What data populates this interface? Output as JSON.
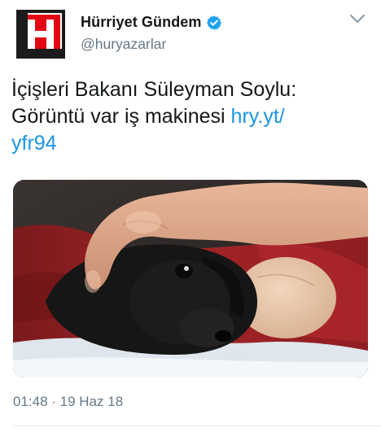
{
  "author": {
    "display_name": "Hürriyet Gündem",
    "handle": "@huryazarlar",
    "avatar_icon": "hurriyet-logo-icon",
    "verified_icon": "verified-badge-icon",
    "colors": {
      "logo_red": "#e30613",
      "logo_dark": "#1b1b1b",
      "verified": "#1da1f2"
    }
  },
  "menu": {
    "icon": "chevron-down-icon"
  },
  "tweet": {
    "line1": "İçişleri Bakanı Süleyman Soylu:",
    "line2_text": "Görüntü var iş makinesi ",
    "link_part1": "hry.yt/",
    "link_part2": "yfr94"
  },
  "media": {
    "kind": "photo",
    "subject": "puppy-photo"
  },
  "footer": {
    "timestamp": "01:48 · 19 Haz 18"
  },
  "colors": {
    "link": "#1b95e0",
    "secondary_text": "#657786",
    "primary_text": "#14171a"
  }
}
